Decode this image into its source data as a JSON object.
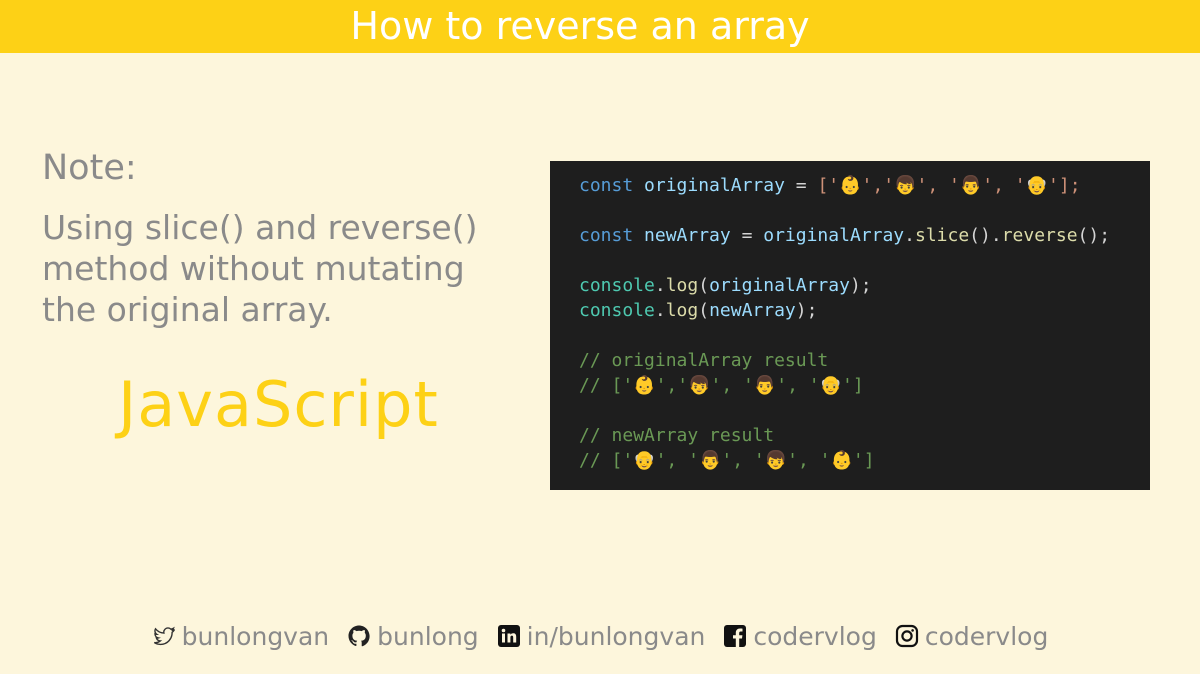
{
  "header": {
    "title": "How to reverse an array"
  },
  "note": {
    "label": "Note:",
    "text": "Using slice() and reverse() method without mutating the original array."
  },
  "language": "JavaScript",
  "code": {
    "line1": {
      "kw": "const",
      "name": "originalArray",
      "eq": " = ",
      "open": "['",
      "e1": "👶",
      "s1": "','",
      "e2": "👦",
      "s2": "', '",
      "e3": "👨",
      "s3": "', '",
      "e4": "👴",
      "close": "'];"
    },
    "line2": {
      "kw": "const",
      "name": "newArray",
      "eq": " = ",
      "src": "originalArray",
      "dot1": ".",
      "fn1": "slice",
      "p1": "().",
      "fn2": "reverse",
      "p2": "();"
    },
    "line3": {
      "obj": "console",
      "dot": ".",
      "fn": "log",
      "open": "(",
      "arg": "originalArray",
      "close": ");"
    },
    "line4": {
      "obj": "console",
      "dot": ".",
      "fn": "log",
      "open": "(",
      "arg": "newArray",
      "close": ");"
    },
    "comment1": "// originalArray result",
    "comment2": "// ['👶','👦', '👨', '👴']",
    "comment3": "// newArray result",
    "comment4": "// ['👴', '👨', '👦', '👶']"
  },
  "footer": {
    "items": [
      {
        "icon": "twitter-icon",
        "label": "bunlongvan"
      },
      {
        "icon": "github-icon",
        "label": "bunlong"
      },
      {
        "icon": "linkedin-icon",
        "label": "in/bunlongvan"
      },
      {
        "icon": "facebook-icon",
        "label": "codervlog"
      },
      {
        "icon": "instagram-icon",
        "label": "codervlog"
      }
    ]
  },
  "colors": {
    "banner": "#fdd116",
    "background": "#fdf6dc",
    "code_background": "#1e1e1e",
    "muted_text": "#8a8a8a"
  }
}
